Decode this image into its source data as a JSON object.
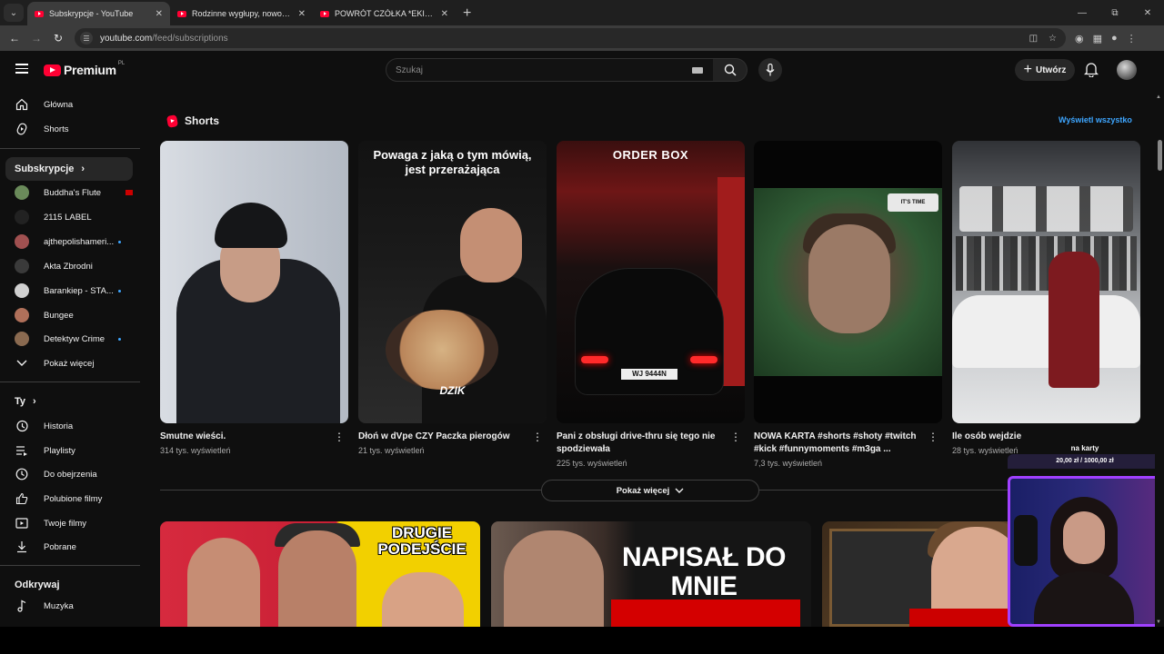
{
  "browser": {
    "tabs": [
      {
        "title": "Subskrypcje - YouTube",
        "active": true
      },
      {
        "title": "Rodzinne wygłupy, nowości czy",
        "active": false
      },
      {
        "title": "POWRÓT CZÓŁKA *EKIPA WK*",
        "active": false
      }
    ],
    "url_domain": "youtube.com",
    "url_path": "/feed/subscriptions"
  },
  "masthead": {
    "logo_text": "Premium",
    "region": "PL",
    "search_placeholder": "Szukaj",
    "create_label": "Utwórz"
  },
  "sidebar": {
    "main": [
      {
        "label": "Główna",
        "icon": "home-icon"
      },
      {
        "label": "Shorts",
        "icon": "shorts-icon"
      }
    ],
    "subscriptions_title": "Subskrypcje",
    "channels": [
      {
        "name": "Buddha's Flute",
        "status": "live",
        "color": "#6a8a5a"
      },
      {
        "name": "2115 LABEL",
        "status": "",
        "color": "#222222"
      },
      {
        "name": "ajthepolishameri...",
        "status": "new",
        "color": "#a05050"
      },
      {
        "name": "Akta Zbrodni",
        "status": "",
        "color": "#3a3a3a"
      },
      {
        "name": "Barankiep - STA...",
        "status": "new",
        "color": "#d0d0d0"
      },
      {
        "name": "Bungee",
        "status": "",
        "color": "#b0705a"
      },
      {
        "name": "Detektyw Crime",
        "status": "new",
        "color": "#8a6a50"
      }
    ],
    "show_more": "Pokaż więcej",
    "you_title": "Ty",
    "you_items": [
      {
        "label": "Historia",
        "icon": "history-icon"
      },
      {
        "label": "Playlisty",
        "icon": "playlist-icon"
      },
      {
        "label": "Do obejrzenia",
        "icon": "watch-later-icon"
      },
      {
        "label": "Polubione filmy",
        "icon": "like-icon"
      },
      {
        "label": "Twoje filmy",
        "icon": "your-videos-icon"
      },
      {
        "label": "Pobrane",
        "icon": "download-icon"
      }
    ],
    "explore_title": "Odkrywaj",
    "explore_items": [
      {
        "label": "Muzyka",
        "icon": "music-icon"
      }
    ]
  },
  "shorts": {
    "heading": "Shorts",
    "show_all": "Wyświetl wszystko",
    "items": [
      {
        "title": "Smutne wieści.",
        "views": "314 tys. wyświetleń"
      },
      {
        "title": "Dłoń w dVpe CZY Paczka pierogów",
        "views": "21 tys. wyświetleń",
        "overlay_caption": "Powaga z jaką o tym mówią, jest przerażająca",
        "overlay_brand": "DZIK"
      },
      {
        "title": "Pani z obsługi drive-thru się tego nie spodziewała",
        "views": "225 tys. wyświetleń",
        "overlay_sign": "ORDER BOX",
        "overlay_plate": "WJ 9444N"
      },
      {
        "title": "NOWA KARTA #shorts #shoty #twitch #kick #funnymoments #m3ga ...",
        "views": "7,3 tys. wyświetleń",
        "overlay_badge": "IT'S TIME"
      },
      {
        "title": "Ile osób wejdzie",
        "views": "28 tys. wyświetleń"
      }
    ],
    "show_more": "Pokaż więcej"
  },
  "videos": [
    {
      "overlay": "DRUGIE PODEJŚCIE"
    },
    {
      "overlay": "NAPISAŁ DO MNIE"
    },
    {
      "overlay": ""
    }
  ],
  "webcam": {
    "label": "na karty",
    "bar_text": "20,00 zł / 1000,00 zł"
  },
  "colors": {
    "accent_red": "#ff0033",
    "link_blue": "#3ea6ff",
    "background": "#0f0f0f",
    "webcam_border": "#a040ff"
  }
}
